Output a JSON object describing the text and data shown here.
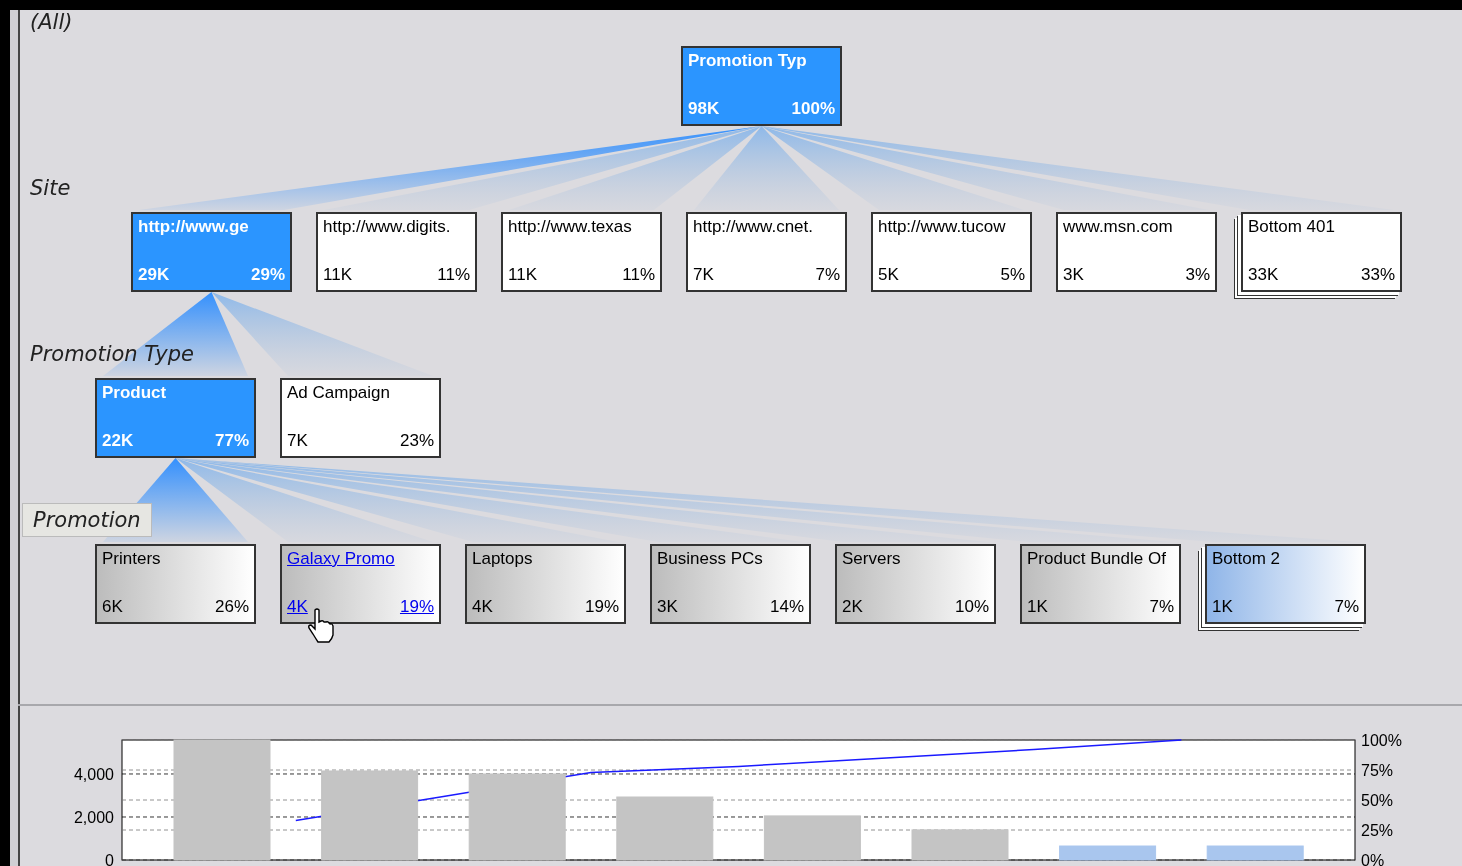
{
  "levels": [
    {
      "label": "(All)",
      "boxed": false,
      "nodes": [
        {
          "name": "Promotion Typ",
          "count": "98K",
          "percent": "100%",
          "selected": true,
          "stacked": false,
          "hovered": false
        }
      ]
    },
    {
      "label": "Site",
      "boxed": false,
      "shaded": false,
      "nodes": [
        {
          "name": "http://www.ge",
          "count": "29K",
          "percent": "29%",
          "selected": true,
          "stacked": false,
          "hovered": false
        },
        {
          "name": "http://www.digits.",
          "count": "11K",
          "percent": "11%",
          "selected": false,
          "stacked": false,
          "hovered": false
        },
        {
          "name": "http://www.texas",
          "count": "11K",
          "percent": "11%",
          "selected": false,
          "stacked": false,
          "hovered": false
        },
        {
          "name": "http://www.cnet.",
          "count": "7K",
          "percent": "7%",
          "selected": false,
          "stacked": false,
          "hovered": false
        },
        {
          "name": "http://www.tucow",
          "count": "5K",
          "percent": "5%",
          "selected": false,
          "stacked": false,
          "hovered": false
        },
        {
          "name": "www.msn.com",
          "count": "3K",
          "percent": "3%",
          "selected": false,
          "stacked": false,
          "hovered": false
        },
        {
          "name": "Bottom 401",
          "count": "33K",
          "percent": "33%",
          "selected": false,
          "stacked": true,
          "hovered": false
        }
      ]
    },
    {
      "label": "Promotion Type",
      "boxed": false,
      "shaded": false,
      "nodes": [
        {
          "name": "Product",
          "count": "22K",
          "percent": "77%",
          "selected": true,
          "stacked": false,
          "hovered": false
        },
        {
          "name": "Ad Campaign",
          "count": "7K",
          "percent": "23%",
          "selected": false,
          "stacked": false,
          "hovered": false
        }
      ]
    },
    {
      "label": "Promotion",
      "boxed": true,
      "shaded": true,
      "nodes": [
        {
          "name": "Printers",
          "count": "6K",
          "percent": "26%",
          "selected": false,
          "stacked": false,
          "hovered": false
        },
        {
          "name": "Galaxy Promo",
          "count": "4K",
          "percent": "19%",
          "selected": false,
          "stacked": false,
          "hovered": true
        },
        {
          "name": "Laptops",
          "count": "4K",
          "percent": "19%",
          "selected": false,
          "stacked": false,
          "hovered": false
        },
        {
          "name": "Business PCs",
          "count": "3K",
          "percent": "14%",
          "selected": false,
          "stacked": false,
          "hovered": false
        },
        {
          "name": "Servers",
          "count": "2K",
          "percent": "10%",
          "selected": false,
          "stacked": false,
          "hovered": false
        },
        {
          "name": "Product Bundle Of",
          "count": "1K",
          "percent": "7%",
          "selected": false,
          "stacked": false,
          "hovered": false
        },
        {
          "name": "Bottom 2",
          "count": "1K",
          "percent": "7%",
          "selected": false,
          "stacked": true,
          "hovered": false
        }
      ]
    }
  ],
  "chart": {
    "chart_data": {
      "type": "bar",
      "grid": true,
      "ylim": [
        0,
        5580
      ],
      "y2lim": [
        0,
        100
      ],
      "yticks": [
        {
          "value": 0,
          "label": "0"
        },
        {
          "value": 2000,
          "label": "2,000"
        },
        {
          "value": 4000,
          "label": "4,000"
        }
      ],
      "y2ticks": [
        {
          "value": 0,
          "label": "0%"
        },
        {
          "value": 25,
          "label": "25%"
        },
        {
          "value": 50,
          "label": "50%"
        },
        {
          "value": 75,
          "label": "75%"
        },
        {
          "value": 100,
          "label": "100%"
        }
      ],
      "series": [
        {
          "type": "bar",
          "color": "#c4c4c4",
          "values": [
            5580,
            4140,
            4000,
            2930,
            2050,
            1400,
            null,
            null
          ]
        },
        {
          "type": "bar",
          "color": "#a9c6ee",
          "values": [
            null,
            null,
            null,
            null,
            null,
            null,
            650,
            650
          ]
        },
        {
          "type": "line",
          "axis": "y2",
          "color": "#1a1aff",
          "values": [
            33,
            53,
            73,
            78,
            85,
            92,
            100,
            null
          ]
        }
      ]
    }
  }
}
